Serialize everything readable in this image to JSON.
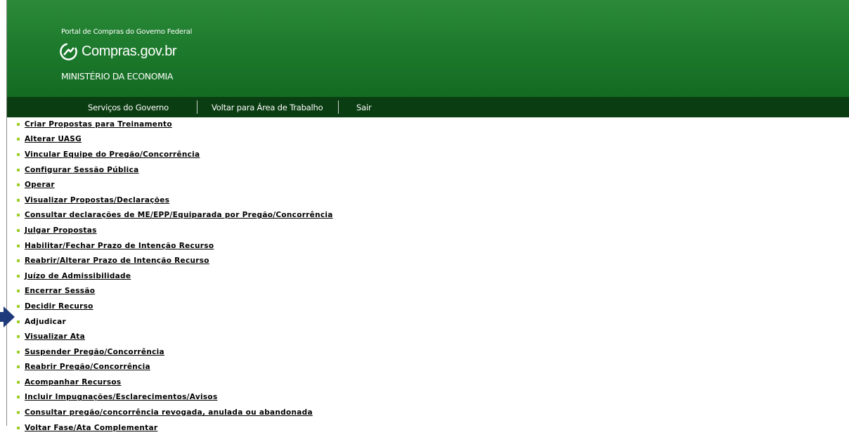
{
  "header": {
    "portal_title": "Portal de Compras do Governo Federal",
    "logo_text": "Compras.gov.br",
    "ministry": "MINISTÉRIO DA ECONOMIA",
    "bg_color": "#1d7a2c"
  },
  "navbar": {
    "bg_color": "#0b3d12",
    "items": [
      {
        "label": "Serviços do Governo"
      },
      {
        "label": "Voltar para Área de Trabalho"
      },
      {
        "label": "Sair"
      }
    ]
  },
  "menu": {
    "bullet_color": "#9ccf2a",
    "pointer_icon": "arrow-right-icon",
    "pointer_color": "#1f3a7a",
    "items": [
      {
        "label": "Criar Propostas para Treinamento"
      },
      {
        "label": "Alterar UASG"
      },
      {
        "label": "Vincular Equipe do Pregão/Concorrência"
      },
      {
        "label": "Configurar Sessão Pública"
      },
      {
        "label": "Operar"
      },
      {
        "label": "Visualizar Propostas/Declarações"
      },
      {
        "label": "Consultar declarações de ME/EPP/Equiparada por Pregão/Concorrência"
      },
      {
        "label": "Julgar Propostas"
      },
      {
        "label": "Habilitar/Fechar Prazo de Intenção Recurso"
      },
      {
        "label": "Reabrir/Alterar Prazo de Intenção Recurso"
      },
      {
        "label": "Juízo de Admissibilidade"
      },
      {
        "label": "Encerrar Sessão"
      },
      {
        "label": "Decidir Recurso"
      },
      {
        "label": "Adjudicar"
      },
      {
        "label": "Visualizar Ata"
      },
      {
        "label": "Suspender Pregão/Concorrência"
      },
      {
        "label": "Reabrir Pregão/Concorrência"
      },
      {
        "label": "Acompanhar Recursos"
      },
      {
        "label": "Incluir Impugnações/Esclarecimentos/Avisos"
      },
      {
        "label": "Consultar pregão/concorrência revogada, anulada ou abandonada"
      },
      {
        "label": "Voltar Fase/Ata Complementar"
      }
    ]
  }
}
